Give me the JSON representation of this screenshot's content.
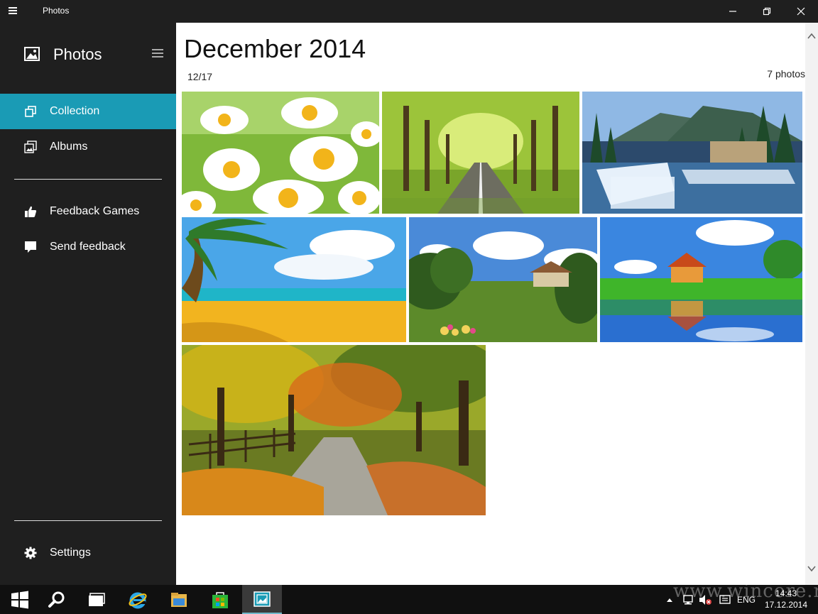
{
  "window": {
    "title": "Photos",
    "controls": {
      "minimize": "minimize-icon",
      "maximize": "restore-icon",
      "close": "close-icon"
    }
  },
  "sidebar": {
    "app_title": "Photos",
    "items": [
      {
        "label": "Collection",
        "icon": "collection-icon",
        "active": true
      },
      {
        "label": "Albums",
        "icon": "albums-icon",
        "active": false
      },
      {
        "label": "Feedback Games",
        "icon": "thumbs-up-icon",
        "active": false
      },
      {
        "label": "Send feedback",
        "icon": "speech-bubble-icon",
        "active": false
      }
    ],
    "settings": {
      "label": "Settings",
      "icon": "gear-icon"
    }
  },
  "main": {
    "title": "December 2014",
    "date": "12/17",
    "count": "7 photos",
    "photos": [
      {
        "name": "photo-daisies"
      },
      {
        "name": "photo-tree-road"
      },
      {
        "name": "photo-waterfall"
      },
      {
        "name": "photo-beach"
      },
      {
        "name": "photo-garden-house"
      },
      {
        "name": "photo-lake-house"
      },
      {
        "name": "photo-autumn-path"
      }
    ]
  },
  "taskbar": {
    "apps": [
      "windows-start-icon",
      "search-icon",
      "task-view-icon",
      "internet-explorer-icon",
      "file-explorer-icon",
      "store-icon",
      "photos-app-icon"
    ],
    "language": "ENG",
    "time": "14:43",
    "date": "17.12.2014",
    "watermark": "www.wincore.ru"
  },
  "colors": {
    "accent": "#1a9bb5",
    "sidebar_bg": "#1f1f1f",
    "taskbar_bg": "#101010"
  }
}
